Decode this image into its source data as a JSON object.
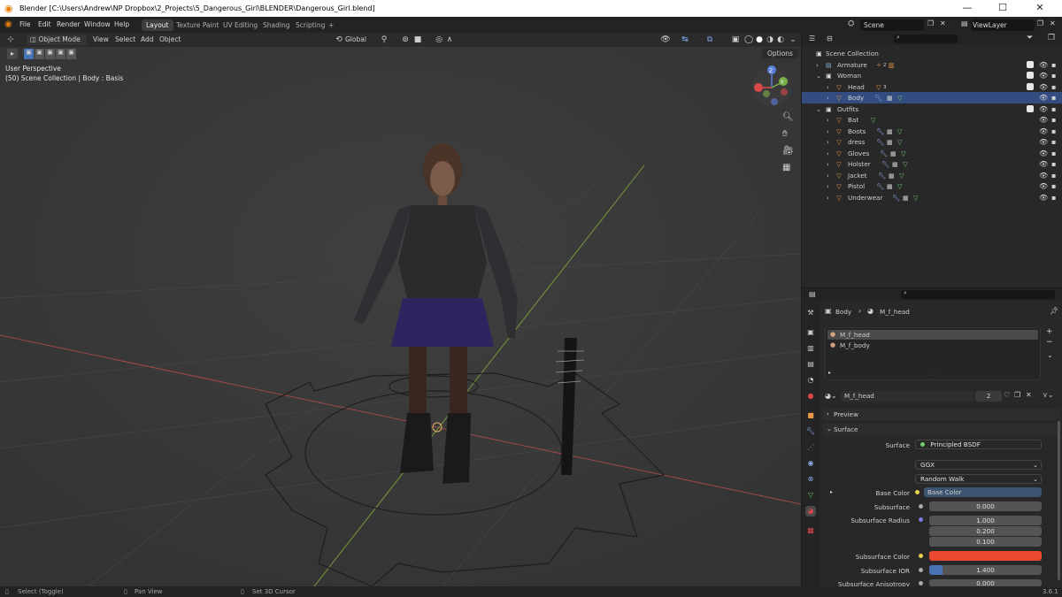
{
  "window": {
    "title": "Blender [C:\\Users\\Andrew\\NP Dropbox\\2_Projects\\5_Dangerous_Girl\\BLENDER\\Dangerous_Girl.blend]",
    "minimize": "—",
    "maximize": "☐",
    "close": "✕"
  },
  "menubar": {
    "items": [
      "File",
      "Edit",
      "Render",
      "Window",
      "Help"
    ],
    "workspaces": [
      "Layout",
      "Texture Paint",
      "UV Editing",
      "Shading",
      "Scripting"
    ],
    "add_workspace": "+",
    "scene_label": "Scene",
    "viewlayer_label": "ViewLayer"
  },
  "viewport": {
    "mode": "Object Mode",
    "menus": [
      "View",
      "Select",
      "Add",
      "Object"
    ],
    "transform_orientation": "Global",
    "options": "Options",
    "info_line1": "User Perspective",
    "info_line2": "(50) Scene Collection | Body : Basis",
    "gizmo_z": "Z",
    "gizmo_y": "Y"
  },
  "outliner": {
    "rows": [
      {
        "label": "Scene Collection",
        "indent": 0,
        "kind": "collection"
      },
      {
        "label": "Armature",
        "indent": 1,
        "kind": "armature",
        "badge": "2"
      },
      {
        "label": "Woman",
        "indent": 1,
        "kind": "collection"
      },
      {
        "label": "Head",
        "indent": 2,
        "kind": "mesh",
        "badge": "3"
      },
      {
        "label": "Body",
        "indent": 2,
        "kind": "mesh"
      },
      {
        "label": "Outfits",
        "indent": 1,
        "kind": "collection"
      },
      {
        "label": "Bat",
        "indent": 2,
        "kind": "mesh"
      },
      {
        "label": "Boots",
        "indent": 2,
        "kind": "mesh"
      },
      {
        "label": "dress",
        "indent": 2,
        "kind": "mesh"
      },
      {
        "label": "Gloves",
        "indent": 2,
        "kind": "mesh"
      },
      {
        "label": "Holster",
        "indent": 2,
        "kind": "mesh"
      },
      {
        "label": "Jacket",
        "indent": 2,
        "kind": "mesh"
      },
      {
        "label": "Pistol",
        "indent": 2,
        "kind": "mesh"
      },
      {
        "label": "Underwear",
        "indent": 2,
        "kind": "mesh"
      }
    ]
  },
  "properties": {
    "breadcrumb_object": "Body",
    "breadcrumb_material": "M_f_head",
    "material_slots": [
      "M_f_head",
      "M_f_body"
    ],
    "material_name": "M_f_head",
    "users": "2",
    "panels": {
      "preview": "Preview",
      "surface": "Surface"
    },
    "surface_label": "Surface",
    "surface_value": "Principled BSDF",
    "distribution": "GGX",
    "subsurface_method": "Random Walk",
    "base_color_label": "Base Color",
    "base_color_value": "Base Color",
    "subsurface_label": "Subsurface",
    "subsurface_value": "0.000",
    "subsurface_radius_label": "Subsurface Radius",
    "subsurface_radius": [
      "1.000",
      "0.200",
      "0.100"
    ],
    "subsurface_color_label": "Subsurface Color",
    "subsurface_color": "#e9492f",
    "subsurface_ior_label": "Subsurface IOR",
    "subsurface_ior_value": "1.400",
    "subsurface_anisotropy_label": "Subsurface Anisotropy",
    "subsurface_anisotropy_value": "0.000"
  },
  "statusbar": {
    "select": "Select (Toggle)",
    "pan": "Pan View",
    "cursor": "Set 3D Cursor",
    "version": "3.6.1"
  },
  "colors": {
    "accent_blue": "#4772b3",
    "mesh_orange": "#e89a47",
    "mesh_green": "#6fcf6f"
  }
}
